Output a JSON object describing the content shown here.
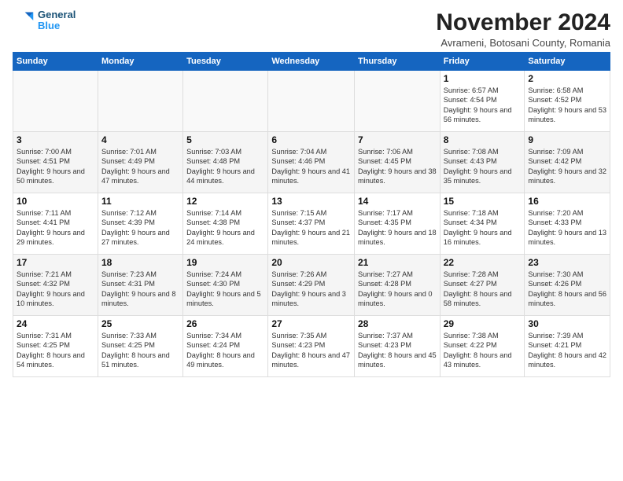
{
  "logo": {
    "line1": "General",
    "line2": "Blue"
  },
  "title": "November 2024",
  "subtitle": "Avrameni, Botosani County, Romania",
  "weekdays": [
    "Sunday",
    "Monday",
    "Tuesday",
    "Wednesday",
    "Thursday",
    "Friday",
    "Saturday"
  ],
  "weeks": [
    [
      {
        "day": "",
        "info": ""
      },
      {
        "day": "",
        "info": ""
      },
      {
        "day": "",
        "info": ""
      },
      {
        "day": "",
        "info": ""
      },
      {
        "day": "",
        "info": ""
      },
      {
        "day": "1",
        "info": "Sunrise: 6:57 AM\nSunset: 4:54 PM\nDaylight: 9 hours and 56 minutes."
      },
      {
        "day": "2",
        "info": "Sunrise: 6:58 AM\nSunset: 4:52 PM\nDaylight: 9 hours and 53 minutes."
      }
    ],
    [
      {
        "day": "3",
        "info": "Sunrise: 7:00 AM\nSunset: 4:51 PM\nDaylight: 9 hours and 50 minutes."
      },
      {
        "day": "4",
        "info": "Sunrise: 7:01 AM\nSunset: 4:49 PM\nDaylight: 9 hours and 47 minutes."
      },
      {
        "day": "5",
        "info": "Sunrise: 7:03 AM\nSunset: 4:48 PM\nDaylight: 9 hours and 44 minutes."
      },
      {
        "day": "6",
        "info": "Sunrise: 7:04 AM\nSunset: 4:46 PM\nDaylight: 9 hours and 41 minutes."
      },
      {
        "day": "7",
        "info": "Sunrise: 7:06 AM\nSunset: 4:45 PM\nDaylight: 9 hours and 38 minutes."
      },
      {
        "day": "8",
        "info": "Sunrise: 7:08 AM\nSunset: 4:43 PM\nDaylight: 9 hours and 35 minutes."
      },
      {
        "day": "9",
        "info": "Sunrise: 7:09 AM\nSunset: 4:42 PM\nDaylight: 9 hours and 32 minutes."
      }
    ],
    [
      {
        "day": "10",
        "info": "Sunrise: 7:11 AM\nSunset: 4:41 PM\nDaylight: 9 hours and 29 minutes."
      },
      {
        "day": "11",
        "info": "Sunrise: 7:12 AM\nSunset: 4:39 PM\nDaylight: 9 hours and 27 minutes."
      },
      {
        "day": "12",
        "info": "Sunrise: 7:14 AM\nSunset: 4:38 PM\nDaylight: 9 hours and 24 minutes."
      },
      {
        "day": "13",
        "info": "Sunrise: 7:15 AM\nSunset: 4:37 PM\nDaylight: 9 hours and 21 minutes."
      },
      {
        "day": "14",
        "info": "Sunrise: 7:17 AM\nSunset: 4:35 PM\nDaylight: 9 hours and 18 minutes."
      },
      {
        "day": "15",
        "info": "Sunrise: 7:18 AM\nSunset: 4:34 PM\nDaylight: 9 hours and 16 minutes."
      },
      {
        "day": "16",
        "info": "Sunrise: 7:20 AM\nSunset: 4:33 PM\nDaylight: 9 hours and 13 minutes."
      }
    ],
    [
      {
        "day": "17",
        "info": "Sunrise: 7:21 AM\nSunset: 4:32 PM\nDaylight: 9 hours and 10 minutes."
      },
      {
        "day": "18",
        "info": "Sunrise: 7:23 AM\nSunset: 4:31 PM\nDaylight: 9 hours and 8 minutes."
      },
      {
        "day": "19",
        "info": "Sunrise: 7:24 AM\nSunset: 4:30 PM\nDaylight: 9 hours and 5 minutes."
      },
      {
        "day": "20",
        "info": "Sunrise: 7:26 AM\nSunset: 4:29 PM\nDaylight: 9 hours and 3 minutes."
      },
      {
        "day": "21",
        "info": "Sunrise: 7:27 AM\nSunset: 4:28 PM\nDaylight: 9 hours and 0 minutes."
      },
      {
        "day": "22",
        "info": "Sunrise: 7:28 AM\nSunset: 4:27 PM\nDaylight: 8 hours and 58 minutes."
      },
      {
        "day": "23",
        "info": "Sunrise: 7:30 AM\nSunset: 4:26 PM\nDaylight: 8 hours and 56 minutes."
      }
    ],
    [
      {
        "day": "24",
        "info": "Sunrise: 7:31 AM\nSunset: 4:25 PM\nDaylight: 8 hours and 54 minutes."
      },
      {
        "day": "25",
        "info": "Sunrise: 7:33 AM\nSunset: 4:25 PM\nDaylight: 8 hours and 51 minutes."
      },
      {
        "day": "26",
        "info": "Sunrise: 7:34 AM\nSunset: 4:24 PM\nDaylight: 8 hours and 49 minutes."
      },
      {
        "day": "27",
        "info": "Sunrise: 7:35 AM\nSunset: 4:23 PM\nDaylight: 8 hours and 47 minutes."
      },
      {
        "day": "28",
        "info": "Sunrise: 7:37 AM\nSunset: 4:23 PM\nDaylight: 8 hours and 45 minutes."
      },
      {
        "day": "29",
        "info": "Sunrise: 7:38 AM\nSunset: 4:22 PM\nDaylight: 8 hours and 43 minutes."
      },
      {
        "day": "30",
        "info": "Sunrise: 7:39 AM\nSunset: 4:21 PM\nDaylight: 8 hours and 42 minutes."
      }
    ]
  ]
}
